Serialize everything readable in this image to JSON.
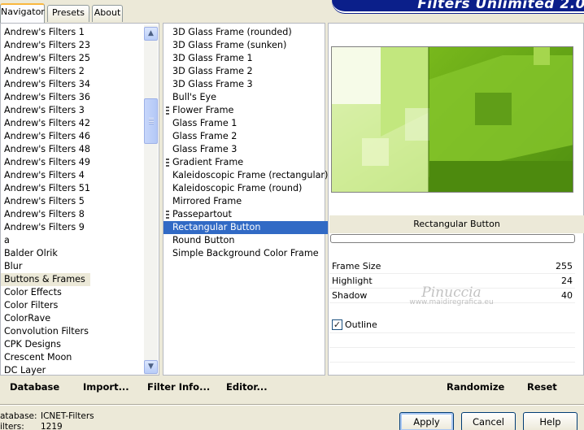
{
  "tabs": [
    {
      "label": "Navigator",
      "active": true
    },
    {
      "label": "Presets",
      "active": false
    },
    {
      "label": "About",
      "active": false
    }
  ],
  "app_title": "Filters Unlimited 2.0",
  "categories": [
    "Andrew's Filters 1",
    "Andrew's Filters 23",
    "Andrew's Filters 25",
    "Andrew's Filters 2",
    "Andrew's Filters 34",
    "Andrew's Filters 36",
    "Andrew's Filters 3",
    "Andrew's Filters 42",
    "Andrew's Filters 46",
    "Andrew's Filters 48",
    "Andrew's Filters 49",
    "Andrew's Filters 4",
    "Andrew's Filters 51",
    "Andrew's Filters 5",
    "Andrew's Filters 8",
    "Andrew's Filters 9",
    "a",
    "Balder Olrik",
    "Blur",
    "Buttons & Frames",
    "Color Effects",
    "Color Filters",
    "ColorRave",
    "Convolution Filters",
    "CPK Designs",
    "Crescent Moon",
    "DC Layer"
  ],
  "selected_category": "Buttons & Frames",
  "filters": [
    {
      "label": "3D Glass Frame (rounded)",
      "grip": false
    },
    {
      "label": "3D Glass Frame (sunken)",
      "grip": false
    },
    {
      "label": "3D Glass Frame 1",
      "grip": false
    },
    {
      "label": "3D Glass Frame 2",
      "grip": false
    },
    {
      "label": "3D Glass Frame 3",
      "grip": false
    },
    {
      "label": "Bull's Eye",
      "grip": false
    },
    {
      "label": "Flower Frame",
      "grip": true
    },
    {
      "label": "Glass Frame 1",
      "grip": false
    },
    {
      "label": "Glass Frame 2",
      "grip": false
    },
    {
      "label": "Glass Frame 3",
      "grip": false
    },
    {
      "label": "Gradient Frame",
      "grip": true
    },
    {
      "label": "Kaleidoscopic Frame (rectangular)",
      "grip": false
    },
    {
      "label": "Kaleidoscopic Frame (round)",
      "grip": false
    },
    {
      "label": "Mirrored Frame",
      "grip": false
    },
    {
      "label": "Passepartout",
      "grip": true
    },
    {
      "label": "Rectangular Button",
      "grip": false
    },
    {
      "label": "Round Button",
      "grip": false
    },
    {
      "label": "Simple Background Color Frame",
      "grip": false
    }
  ],
  "selected_filter": "Rectangular Button",
  "preview": {
    "filter_name": "Rectangular Button"
  },
  "params": [
    {
      "name": "Frame Size",
      "value": "255"
    },
    {
      "name": "Highlight",
      "value": "24"
    },
    {
      "name": "Shadow",
      "value": "40"
    }
  ],
  "outline": {
    "label": "Outline",
    "checked": true
  },
  "watermark": {
    "name": "Pinuccia",
    "url": "www.maidiregrafica.eu"
  },
  "toolbar": {
    "database": "Database",
    "import": "Import...",
    "filter_info": "Filter Info...",
    "editor": "Editor...",
    "randomize": "Randomize",
    "reset": "Reset"
  },
  "status": {
    "database_key": "atabase:",
    "database_value": "ICNET-Filters",
    "filters_key": "ilters:",
    "filters_value": "1219"
  },
  "buttons": {
    "apply": "Apply",
    "cancel": "Cancel",
    "help": "Help"
  },
  "colors": {
    "selection": "#316ac5",
    "banner": "#0b1f8a"
  }
}
